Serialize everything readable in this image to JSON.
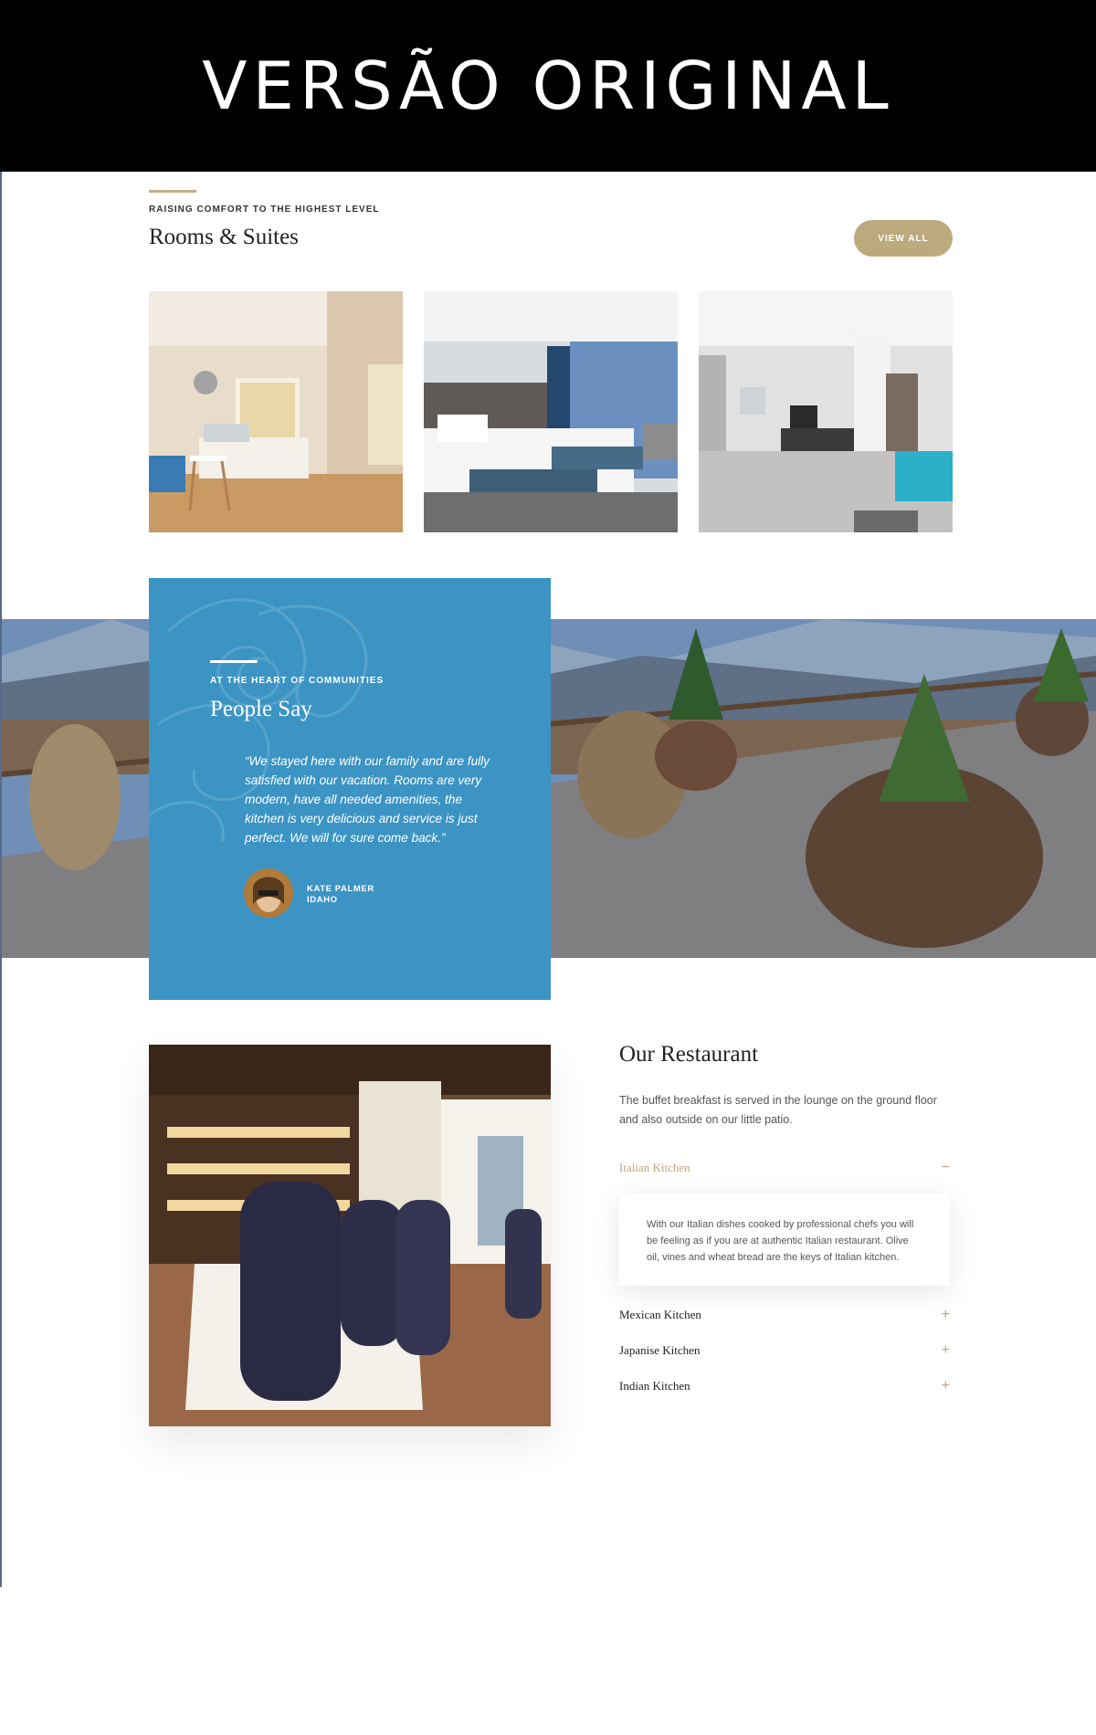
{
  "banner": {
    "title": "VERSÃO ORIGINAL"
  },
  "rooms": {
    "kicker": "RAISING COMFORT TO THE HIGHEST LEVEL",
    "title": "Rooms & Suites",
    "view_all_label": "VIEW ALL",
    "images": [
      "room-photo-1",
      "room-photo-2",
      "room-photo-3"
    ]
  },
  "testimonial": {
    "kicker": "AT THE HEART OF COMMUNITIES",
    "title": "People Say",
    "quote": "“We stayed here with our family and are fully satisfied with our vacation. Rooms are very modern, have all needed amenities, the kitchen is very delicious and service is just perfect. We will for sure come back.”",
    "author_name": "KATE PALMER",
    "author_location": "IDAHO"
  },
  "restaurant": {
    "title": "Our Restaurant",
    "description": "The buffet breakfast is served in the lounge on the ground floor and also outside on our little patio.",
    "accordion": [
      {
        "label": "Italian Kitchen",
        "expanded": true,
        "toggle": "−",
        "content": "With our Italian dishes cooked by professional chefs you will be feeling as if you are at authentic Italian restaurant. Olive oil, vines and wheat bread are the keys of Italian kitchen."
      },
      {
        "label": "Mexican Kitchen",
        "expanded": false,
        "toggle": "+"
      },
      {
        "label": "Japanise Kitchen",
        "expanded": false,
        "toggle": "+"
      },
      {
        "label": "Indian Kitchen",
        "expanded": false,
        "toggle": "+"
      }
    ]
  },
  "colors": {
    "accent_gold": "#bcaa7e",
    "testimonial_blue": "#3b94c4",
    "banner_black": "#000000"
  }
}
